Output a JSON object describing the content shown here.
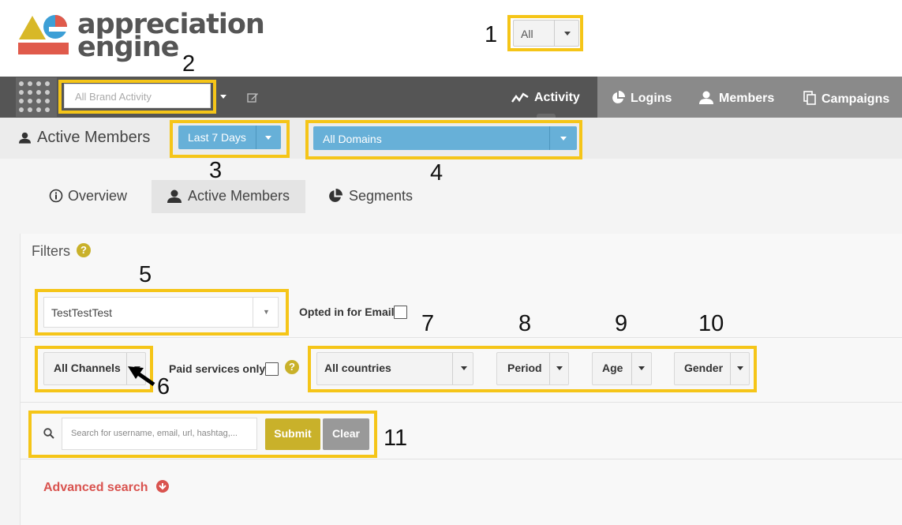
{
  "app": {
    "logo_line1": "appreciation",
    "logo_line2": "engine",
    "top_select": "All"
  },
  "navbar": {
    "brand_placeholder": "All Brand Activity",
    "items": [
      {
        "label": "Activity",
        "icon": "activity-line-icon"
      },
      {
        "label": "Logins",
        "icon": "pie-chart-icon"
      },
      {
        "label": "Members",
        "icon": "user-icon"
      },
      {
        "label": "Campaigns",
        "icon": "copy-icon"
      }
    ]
  },
  "subbar": {
    "title": "Active Members",
    "date_range": "Last 7 Days",
    "domains": "All Domains"
  },
  "tabs": [
    {
      "label": "Overview",
      "icon": "info-icon"
    },
    {
      "label": "Active Members",
      "icon": "user-icon",
      "active": true
    },
    {
      "label": "Segments",
      "icon": "pie-chart-icon"
    }
  ],
  "filters": {
    "heading": "Filters",
    "segment_select": "TestTestTest",
    "opted_in_label": "Opted in for Email:",
    "channels": "All Channels",
    "paid_label": "Paid services only:",
    "countries": "All countries",
    "period": "Period",
    "age": "Age",
    "gender": "Gender",
    "search_placeholder": "Search for username, email, url, hashtag,...",
    "submit": "Submit",
    "clear": "Clear",
    "advanced": "Advanced search"
  },
  "annotations": [
    "1",
    "2",
    "3",
    "4",
    "5",
    "6",
    "7",
    "8",
    "9",
    "10",
    "11"
  ],
  "colors": {
    "highlight": "#f5c518",
    "navbar": "#555555",
    "blue": "#67b0d8",
    "submit": "#c9b12a",
    "clear": "#999999",
    "advanced": "#d9534f",
    "logo_red": "#e05a4b",
    "logo_yellow": "#d8b828",
    "logo_blue": "#3d9fd6"
  }
}
